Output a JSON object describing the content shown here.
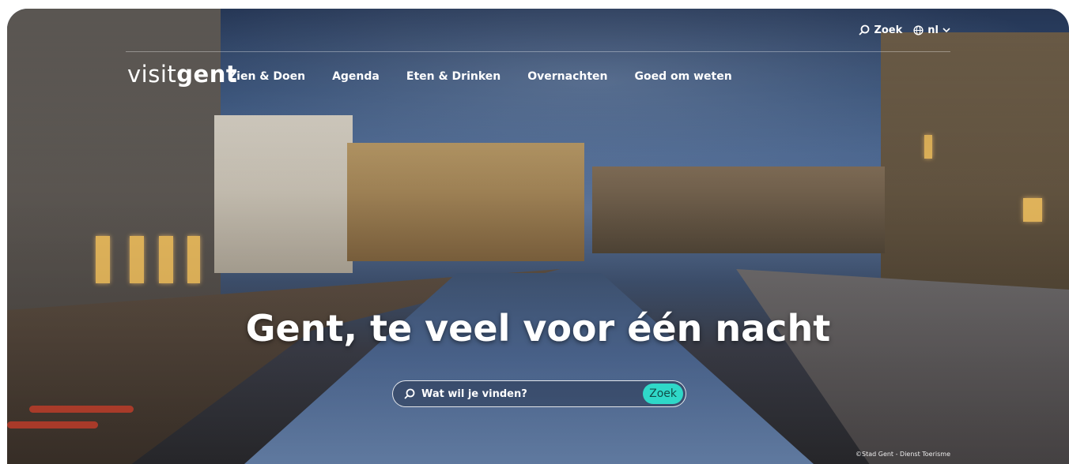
{
  "brand": {
    "light": "visit",
    "bold": "gent"
  },
  "topbar": {
    "search_label": "Zoek",
    "language_label": "nl",
    "search_icon": "search-icon",
    "language_icon": "globe-icon",
    "chevron_icon": "chevron-down-icon"
  },
  "nav": {
    "items": [
      {
        "label": "Zien & Doen"
      },
      {
        "label": "Agenda"
      },
      {
        "label": "Eten & Drinken"
      },
      {
        "label": "Overnachten"
      },
      {
        "label": "Goed om weten"
      }
    ]
  },
  "hero": {
    "headline": "Gent, te veel voor één nacht",
    "search_placeholder": "Wat wil je vinden?",
    "search_button": "Zoek",
    "credit": "©Stad Gent - Dienst Toerisme"
  },
  "colors": {
    "accent": "#2fd8c8",
    "text": "#ffffff"
  }
}
